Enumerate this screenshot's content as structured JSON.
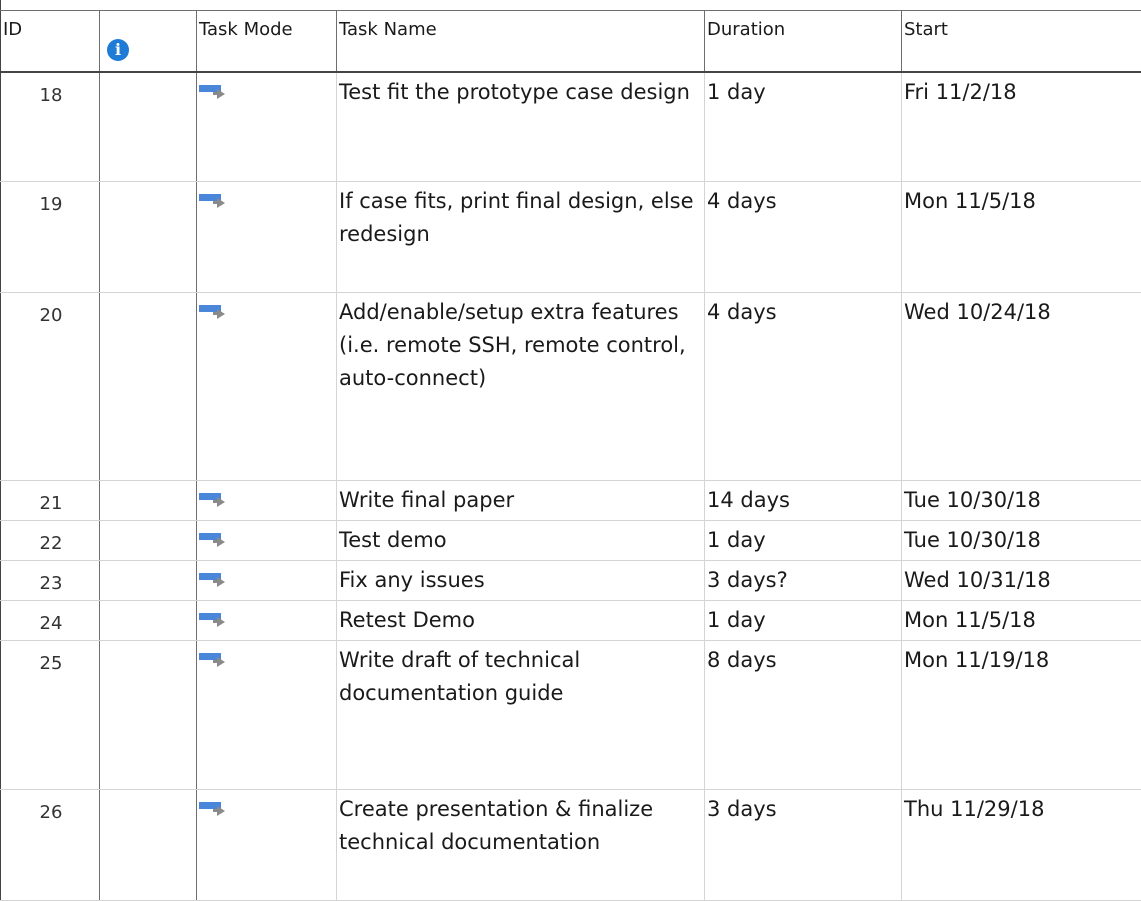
{
  "columns": {
    "id": "ID",
    "indicators": "",
    "task_mode": "Task Mode",
    "task_name": "Task Name",
    "duration": "Duration",
    "start": "Start"
  },
  "icons": {
    "indicator_header": "info-icon",
    "task_mode": "auto-scheduled-task-icon"
  },
  "rows": [
    {
      "id": "18",
      "name": "Test fit the prototype case design",
      "duration": "1 day",
      "start": "Fri 11/2/18"
    },
    {
      "id": "19",
      "name": "If case fits, print final design, else redesign",
      "duration": "4 days",
      "start": "Mon 11/5/18"
    },
    {
      "id": "20",
      "name": "Add/enable/setup extra features (i.e. remote SSH, remote control, auto-connect)",
      "duration": "4 days",
      "start": "Wed 10/24/18"
    },
    {
      "id": "21",
      "name": "Write final paper",
      "duration": "14 days",
      "start": "Tue 10/30/18"
    },
    {
      "id": "22",
      "name": "Test demo",
      "duration": "1 day",
      "start": "Tue 10/30/18"
    },
    {
      "id": "23",
      "name": "Fix any issues",
      "duration": "3 days?",
      "start": "Wed 10/31/18"
    },
    {
      "id": "24",
      "name": "Retest Demo",
      "duration": "1 day",
      "start": "Mon 11/5/18"
    },
    {
      "id": "25",
      "name": "Write draft of technical documentation guide",
      "duration": "8 days",
      "start": "Mon 11/19/18"
    },
    {
      "id": "26",
      "name": "Create presentation & finalize technical documentation",
      "duration": "3 days",
      "start": "Thu 11/29/18"
    }
  ]
}
